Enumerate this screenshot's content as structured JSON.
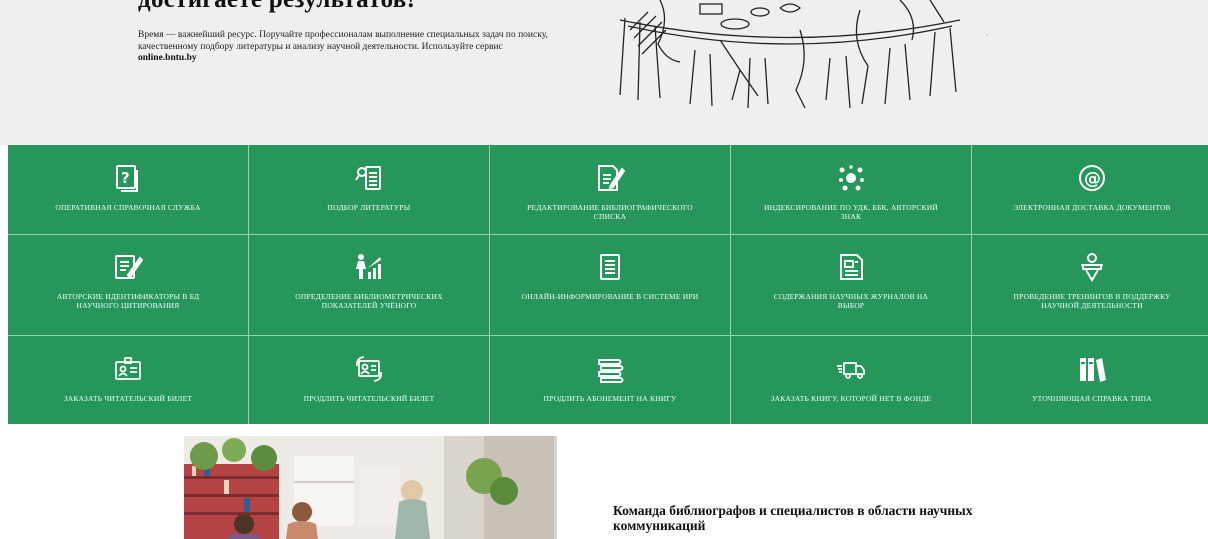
{
  "hero": {
    "heading": "достигаете результатов!",
    "text": "Время — важнейший ресурс. Поручайте профессионалам выполнение специальных задач по поиску, качественному подбору литературы и анализу научной деятельности. Используйте сервис",
    "link": "online.bntu.by"
  },
  "services": [
    {
      "label": "ОПЕРАТИВНАЯ СПРАВОЧНАЯ СЛУЖБА",
      "icon": "question-icon"
    },
    {
      "label": "ПОДБОР ЛИТЕРАТУРЫ",
      "icon": "document-search-icon"
    },
    {
      "label": "РЕДАКТИРОВАНИЕ БИБЛИОГРАФИЧЕСКОГО СПИСКА",
      "icon": "document-edit-icon"
    },
    {
      "label": "ИНДЕКСИРОВАНИЕ ПО УДК, ББК, АВТОРСКИЙ ЗНАК",
      "icon": "network-icon"
    },
    {
      "label": "ЭЛЕКТРОННАЯ ДОСТАВКА ДОКУМЕНТОВ",
      "icon": "at-sign-icon"
    },
    {
      "label": "АВТОРСКИЕ ИДЕНТИФИКАТОРЫ В БД НАУЧНОГО ЦИТИРОВАНИЯ",
      "icon": "author-id-icon"
    },
    {
      "label": "ОПРЕДЕЛЕНИЕ БИБЛИОМЕТРИЧЕСКИХ ПОКАЗАТЕЛЕЙ УЧЁНОГО",
      "icon": "growth-chart-icon"
    },
    {
      "label": "ОНЛАЙН-ИНФОРМИРОВАНИЕ В СИСТЕМЕ ИРИ",
      "icon": "list-document-icon"
    },
    {
      "label": "СОДЕРЖАНИЯ НАУЧНЫХ ЖУРНАЛОВ НА ВЫБОР",
      "icon": "journal-icon"
    },
    {
      "label": "ПРОВЕДЕНИЕ ТРЕНИНГОВ В ПОДДЕРЖКУ НАУЧНОЙ ДЕЯТЕЛЬНОСТИ",
      "icon": "trainer-icon"
    },
    {
      "label": "ЗАКАЗАТЬ ЧИТАТЕЛЬСКИЙ БИЛЕТ",
      "icon": "id-card-icon"
    },
    {
      "label": "ПРОДЛИТЬ ЧИТАТЕЛЬСКИЙ БИЛЕТ",
      "icon": "card-renew-icon"
    },
    {
      "label": "ПРОДЛИТЬ АБОНЕМЕНТ НА КНИГУ",
      "icon": "books-stack-icon"
    },
    {
      "label": "ЗАКАЗАТЬ КНИГУ, КОТОРОЙ НЕТ В ФОНДЕ",
      "icon": "delivery-truck-icon"
    },
    {
      "label": "УТОЧНЯЮЩАЯ СПРАВКА ТНПА",
      "icon": "binders-icon"
    }
  ],
  "team": {
    "title": "Команда библиографов и специалистов в области научных коммуникаций"
  },
  "colors": {
    "tile_green": "#26965a",
    "hero_bg": "#efefef"
  }
}
